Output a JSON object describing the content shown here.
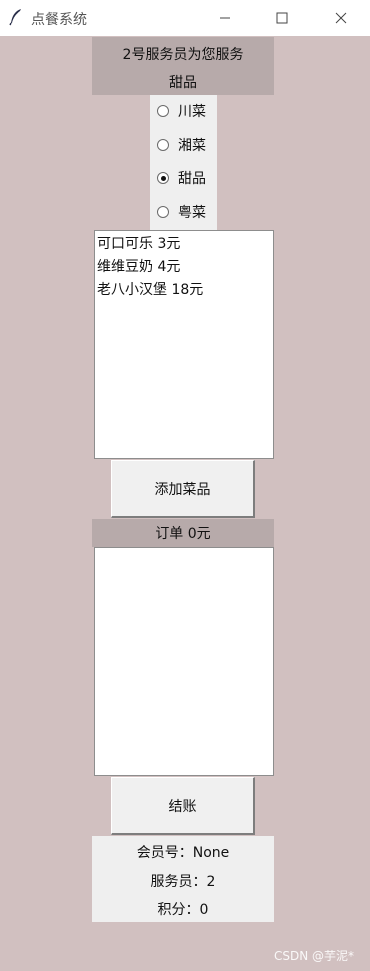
{
  "window": {
    "title": "点餐系统",
    "icon": "feather-icon",
    "controls": [
      "minimize-icon",
      "maximize-icon",
      "close-icon"
    ]
  },
  "header": {
    "line1": "2号服务员为您服务",
    "line2": "甜品"
  },
  "categories": {
    "options": [
      "川菜",
      "湘菜",
      "甜品",
      "粤菜"
    ],
    "selected": "甜品"
  },
  "menu_list": {
    "items": [
      "可口可乐 3元",
      "维维豆奶 4元",
      "老八小汉堡 18元"
    ]
  },
  "add_button": "添加菜品",
  "order": {
    "label": "订单 0元",
    "items": []
  },
  "checkout_button": "结账",
  "info": {
    "member": "会员号：None",
    "waiter": "服务员：2",
    "points": "积分：0"
  },
  "watermark": "CSDN @芋泥*",
  "colors": {
    "background": "#d1c0c0",
    "header_bg": "#b7aaaa",
    "panel_bg": "#efefef"
  }
}
